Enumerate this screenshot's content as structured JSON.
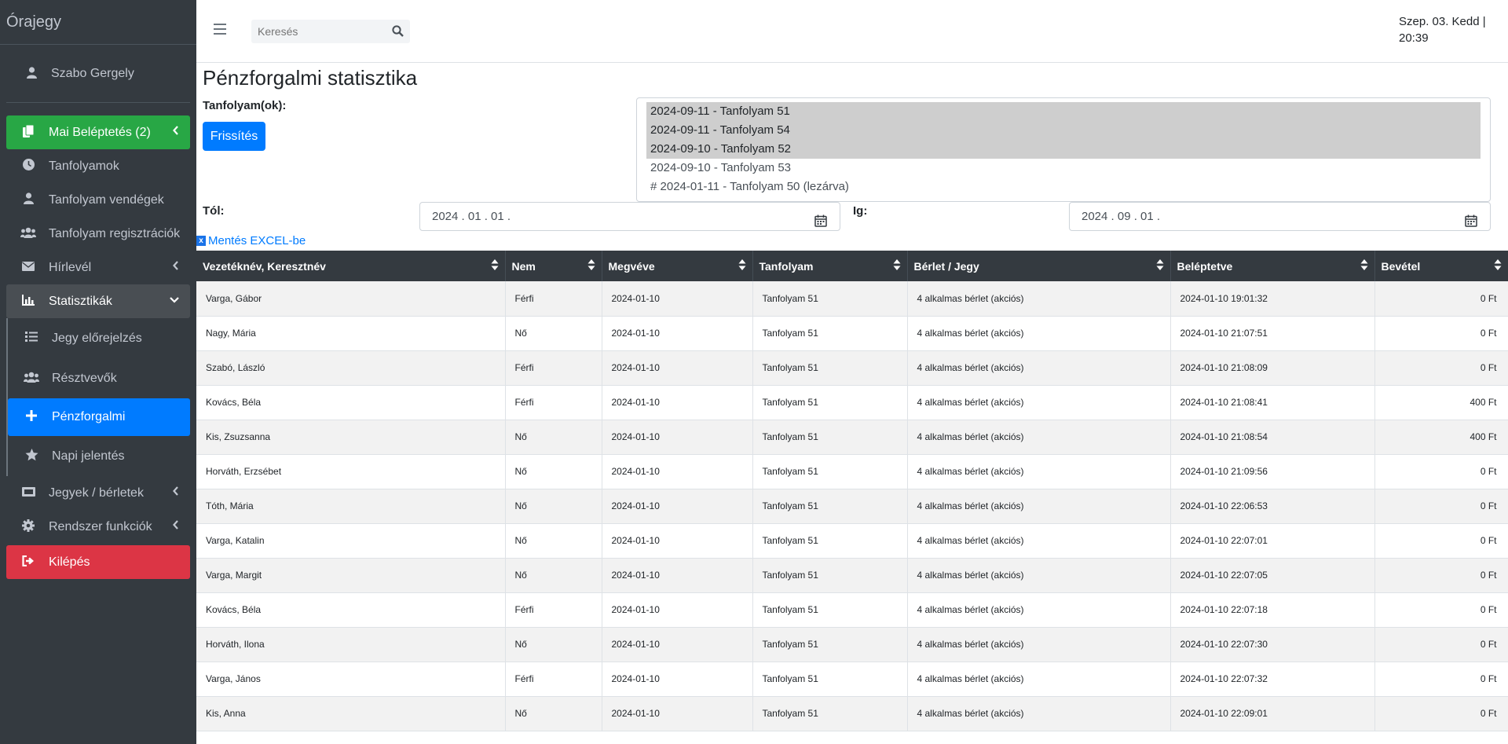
{
  "brand": "Órajegy",
  "user": {
    "name": "Szabo Gergely"
  },
  "nav": {
    "daily": "Mai Beléptetés (2)",
    "courses": "Tanfolyamok",
    "course_guests": "Tanfolyam vendégek",
    "course_regs": "Tanfolyam regisztrációk",
    "newsletter": "Hírlevél",
    "stats": "Statisztikák",
    "sub": {
      "ticket_forecast": "Jegy előrejelzés",
      "participants": "Résztvevők",
      "financial": "Pénzforgalmi",
      "daily_report": "Napi jelentés"
    },
    "tickets": "Jegyek / bérletek",
    "system": "Rendszer funkciók",
    "logout": "Kilépés"
  },
  "header": {
    "search_placeholder": "Keresés",
    "datetime_line1": "Szep. 03. Kedd |",
    "datetime_line2": "20:39"
  },
  "page": {
    "title": "Pénzforgalmi statisztika",
    "courses_label": "Tanfolyam(ok):",
    "refresh": "Frissítés",
    "from_label": "Tól:",
    "to_label": "Ig:",
    "from_date": "2024 .  01 .  01 .",
    "to_date": "2024 .  09 .  01 .",
    "excel": "Mentés EXCEL-be",
    "course_options": [
      {
        "label": "2024-09-11 - Tanfolyam 51",
        "selected": true
      },
      {
        "label": "2024-09-11 - Tanfolyam 54",
        "selected": true
      },
      {
        "label": "2024-09-10 - Tanfolyam 52",
        "selected": true
      },
      {
        "label": "2024-09-10 - Tanfolyam 53",
        "selected": false
      },
      {
        "label": "# 2024-01-11 - Tanfolyam 50 (lezárva)",
        "selected": false
      }
    ]
  },
  "table": {
    "headers": [
      "Vezetéknév, Keresztnév",
      "Nem",
      "Megvéve",
      "Tanfolyam",
      "Bérlet / Jegy",
      "Beléptetve",
      "Bevétel"
    ],
    "rows": [
      [
        "Varga, Gábor",
        "Férfi",
        "2024-01-10",
        "Tanfolyam 51",
        "4 alkalmas bérlet (akciós)",
        "2024-01-10 19:01:32",
        "0 Ft"
      ],
      [
        "Nagy, Mária",
        "Nő",
        "2024-01-10",
        "Tanfolyam 51",
        "4 alkalmas bérlet (akciós)",
        "2024-01-10 21:07:51",
        "0 Ft"
      ],
      [
        "Szabó, László",
        "Férfi",
        "2024-01-10",
        "Tanfolyam 51",
        "4 alkalmas bérlet (akciós)",
        "2024-01-10 21:08:09",
        "0 Ft"
      ],
      [
        "Kovács, Béla",
        "Férfi",
        "2024-01-10",
        "Tanfolyam 51",
        "4 alkalmas bérlet (akciós)",
        "2024-01-10 21:08:41",
        "400 Ft"
      ],
      [
        "Kis, Zsuzsanna",
        "Nő",
        "2024-01-10",
        "Tanfolyam 51",
        "4 alkalmas bérlet (akciós)",
        "2024-01-10 21:08:54",
        "400 Ft"
      ],
      [
        "Horváth, Erzsébet",
        "Nő",
        "2024-01-10",
        "Tanfolyam 51",
        "4 alkalmas bérlet (akciós)",
        "2024-01-10 21:09:56",
        "0 Ft"
      ],
      [
        "Tóth, Mária",
        "Nő",
        "2024-01-10",
        "Tanfolyam 51",
        "4 alkalmas bérlet (akciós)",
        "2024-01-10 22:06:53",
        "0 Ft"
      ],
      [
        "Varga, Katalin",
        "Nő",
        "2024-01-10",
        "Tanfolyam 51",
        "4 alkalmas bérlet (akciós)",
        "2024-01-10 22:07:01",
        "0 Ft"
      ],
      [
        "Varga, Margit",
        "Nő",
        "2024-01-10",
        "Tanfolyam 51",
        "4 alkalmas bérlet (akciós)",
        "2024-01-10 22:07:05",
        "0 Ft"
      ],
      [
        "Kovács, Béla",
        "Férfi",
        "2024-01-10",
        "Tanfolyam 51",
        "4 alkalmas bérlet (akciós)",
        "2024-01-10 22:07:18",
        "0 Ft"
      ],
      [
        "Horváth, Ilona",
        "Nő",
        "2024-01-10",
        "Tanfolyam 51",
        "4 alkalmas bérlet (akciós)",
        "2024-01-10 22:07:30",
        "0 Ft"
      ],
      [
        "Varga, János",
        "Férfi",
        "2024-01-10",
        "Tanfolyam 51",
        "4 alkalmas bérlet (akciós)",
        "2024-01-10 22:07:32",
        "0 Ft"
      ],
      [
        "Kis, Anna",
        "Nő",
        "2024-01-10",
        "Tanfolyam 51",
        "4 alkalmas bérlet (akciós)",
        "2024-01-10 22:09:01",
        "0 Ft"
      ]
    ]
  }
}
